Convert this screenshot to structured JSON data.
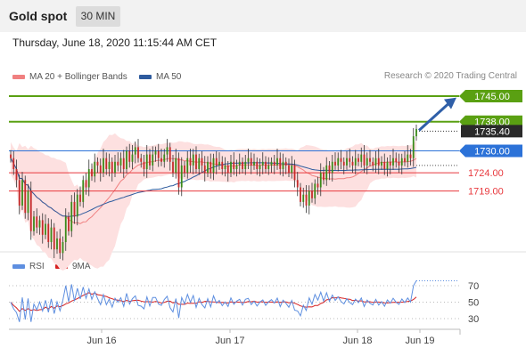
{
  "header": {
    "title": "Gold spot",
    "timeframe": "30 MIN"
  },
  "datetime": "Thursday, June 18, 2020 11:15:44 AM CET",
  "legend": {
    "bb": "MA 20 + Bollinger Bands",
    "ma50": "MA 50",
    "rsi": "RSI",
    "rsi_ma": "9MA"
  },
  "copyright": "Research © 2020 Trading Central",
  "colors": {
    "resistance": "#5aa012",
    "support": "#e8383d",
    "pivot": "#2c72d8",
    "ma50": "#2e5b9e",
    "bb": "#f08080",
    "bb_fill": "#fde0e0",
    "rsi": "#5e8fe0",
    "rsi_ma": "#d62020",
    "candle_up": "#3a8a1a",
    "candle_down": "#c52a2a",
    "arrow": "#2f5fa8"
  },
  "chart_data": [
    {
      "type": "candlestick",
      "title": "Gold spot",
      "x_labels": [
        "Jun 16",
        "Jun 17",
        "Jun 18",
        "Jun 19"
      ],
      "ylim": [
        1700,
        1752
      ],
      "levels": [
        {
          "value": 1745.0,
          "label": "1745.00",
          "kind": "resistance"
        },
        {
          "value": 1738.0,
          "label": "1738.00",
          "kind": "resistance"
        },
        {
          "value": 1735.4,
          "label": "1735.40",
          "kind": "last"
        },
        {
          "value": 1730.0,
          "label": "1730.00",
          "kind": "pivot"
        },
        {
          "value": 1724.0,
          "label": "1724.00",
          "kind": "support"
        },
        {
          "value": 1719.0,
          "label": "1719.00",
          "kind": "support"
        }
      ],
      "series": [
        {
          "name": "MA 20 + Bollinger Bands",
          "kind": "ma20_bb"
        },
        {
          "name": "MA 50",
          "kind": "ma50"
        }
      ],
      "candles": [
        1728,
        1725,
        1722,
        1715,
        1722,
        1713,
        1719,
        1708,
        1712,
        1709,
        1711,
        1707,
        1710,
        1705,
        1709,
        1703,
        1706,
        1702,
        1705,
        1712,
        1708,
        1716,
        1712,
        1718,
        1716,
        1722,
        1720,
        1725,
        1723,
        1727,
        1726,
        1724,
        1728,
        1725,
        1727,
        1724,
        1727,
        1726,
        1728,
        1725,
        1730,
        1727,
        1729,
        1731,
        1728,
        1727,
        1725,
        1729,
        1726,
        1729,
        1730,
        1728,
        1727,
        1729,
        1731,
        1727,
        1724,
        1728,
        1720,
        1726,
        1724,
        1728,
        1726,
        1729,
        1725,
        1728,
        1726,
        1724,
        1727,
        1724,
        1728,
        1726,
        1727,
        1725,
        1726,
        1724,
        1727,
        1725,
        1726,
        1727,
        1725,
        1727,
        1728,
        1726,
        1727,
        1725,
        1726,
        1727,
        1725,
        1726,
        1727,
        1726,
        1728,
        1725,
        1727,
        1726,
        1724,
        1726,
        1722,
        1720,
        1716,
        1718,
        1715,
        1719,
        1717,
        1721,
        1720,
        1724,
        1722,
        1726,
        1724,
        1727,
        1726,
        1728,
        1727,
        1726,
        1728,
        1727,
        1726,
        1728,
        1727,
        1729,
        1726,
        1728,
        1727,
        1726,
        1728,
        1726,
        1727,
        1725,
        1727,
        1726,
        1728,
        1727,
        1726,
        1728,
        1727,
        1729,
        1728,
        1734,
        1736
      ],
      "rsi": {
        "levels": [
          70,
          50,
          30
        ],
        "last": 76
      }
    }
  ]
}
